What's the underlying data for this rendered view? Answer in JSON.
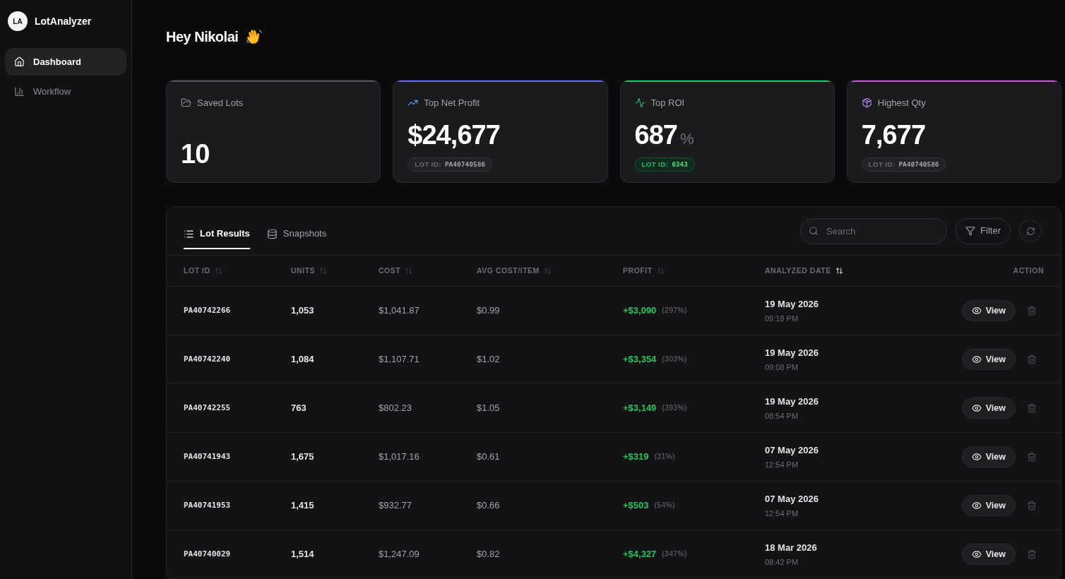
{
  "sidebar": {
    "logo_initials": "LA",
    "app_name": "LotAnalyzer",
    "items": [
      {
        "label": "Dashboard",
        "selected": true
      },
      {
        "label": "Workflow",
        "selected": false
      }
    ]
  },
  "greeting": "Hey Nikolai",
  "cards": [
    {
      "kind": "count",
      "label": "Saved Lots",
      "value": "10",
      "color": "#52525b"
    },
    {
      "kind": "metric",
      "label": "Top Net Profit",
      "value": "$24,677",
      "color": "#6366f1",
      "badge": {
        "label": "LOT ID:",
        "value": "PA40740586",
        "highlighted": false
      }
    },
    {
      "kind": "metric",
      "label": "Top ROI",
      "value": "687",
      "unit": "%",
      "color": "#22c55e",
      "badge": {
        "label": "LOT ID:",
        "value": "6343",
        "highlighted": true
      }
    },
    {
      "kind": "metric",
      "label": "Highest Qty",
      "value": "7,677",
      "color": "#c054d8",
      "badge": {
        "label": "LOT ID:",
        "value": "PA40740586",
        "highlighted": false
      }
    }
  ],
  "results": {
    "tabs": [
      {
        "label": "Lot Results",
        "selected": true
      },
      {
        "label": "Snapshots",
        "selected": false
      }
    ],
    "search": {
      "placeholder": "Search"
    },
    "filter_label": "Filter",
    "table": {
      "columns": [
        {
          "label": "LOT ID",
          "sortable": true,
          "sorted": false
        },
        {
          "label": "UNITS",
          "sortable": true,
          "sorted": false
        },
        {
          "label": "COST",
          "sortable": true,
          "sorted": false
        },
        {
          "label": "AVG COST/ITEM",
          "sortable": true,
          "sorted": false
        },
        {
          "label": "PROFIT",
          "sortable": true,
          "sorted": false
        },
        {
          "label": "ANALYZED DATE",
          "sortable": true,
          "sorted": true
        },
        {
          "label": "ACTION",
          "sortable": false
        }
      ],
      "rows": [
        {
          "lot_id": "PA40742266",
          "units": "1,053",
          "cost": "$1,041.87",
          "avg_cost": "$0.99",
          "profit": "+$3,090",
          "profit_pct": "(297%)",
          "date": "19 May 2026",
          "time": "09:18 PM",
          "view_label": "View"
        },
        {
          "lot_id": "PA40742240",
          "units": "1,084",
          "cost": "$1,107.71",
          "avg_cost": "$1.02",
          "profit": "+$3,354",
          "profit_pct": "(303%)",
          "date": "19 May 2026",
          "time": "09:08 PM",
          "view_label": "View"
        },
        {
          "lot_id": "PA40742255",
          "units": "763",
          "cost": "$802.23",
          "avg_cost": "$1.05",
          "profit": "+$3,149",
          "profit_pct": "(393%)",
          "date": "19 May 2026",
          "time": "08:54 PM",
          "view_label": "View"
        },
        {
          "lot_id": "PA40741943",
          "units": "1,675",
          "cost": "$1,017.16",
          "avg_cost": "$0.61",
          "profit": "+$319",
          "profit_pct": "(31%)",
          "date": "07 May 2026",
          "time": "12:54 PM",
          "view_label": "View"
        },
        {
          "lot_id": "PA40741953",
          "units": "1,415",
          "cost": "$932.77",
          "avg_cost": "$0.66",
          "profit": "+$503",
          "profit_pct": "(54%)",
          "date": "07 May 2026",
          "time": "12:54 PM",
          "view_label": "View"
        },
        {
          "lot_id": "PA40740029",
          "units": "1,514",
          "cost": "$1,247.09",
          "avg_cost": "$0.82",
          "profit": "+$4,327",
          "profit_pct": "(347%)",
          "date": "18 Mar 2026",
          "time": "08:42 PM",
          "view_label": "View"
        }
      ]
    }
  }
}
